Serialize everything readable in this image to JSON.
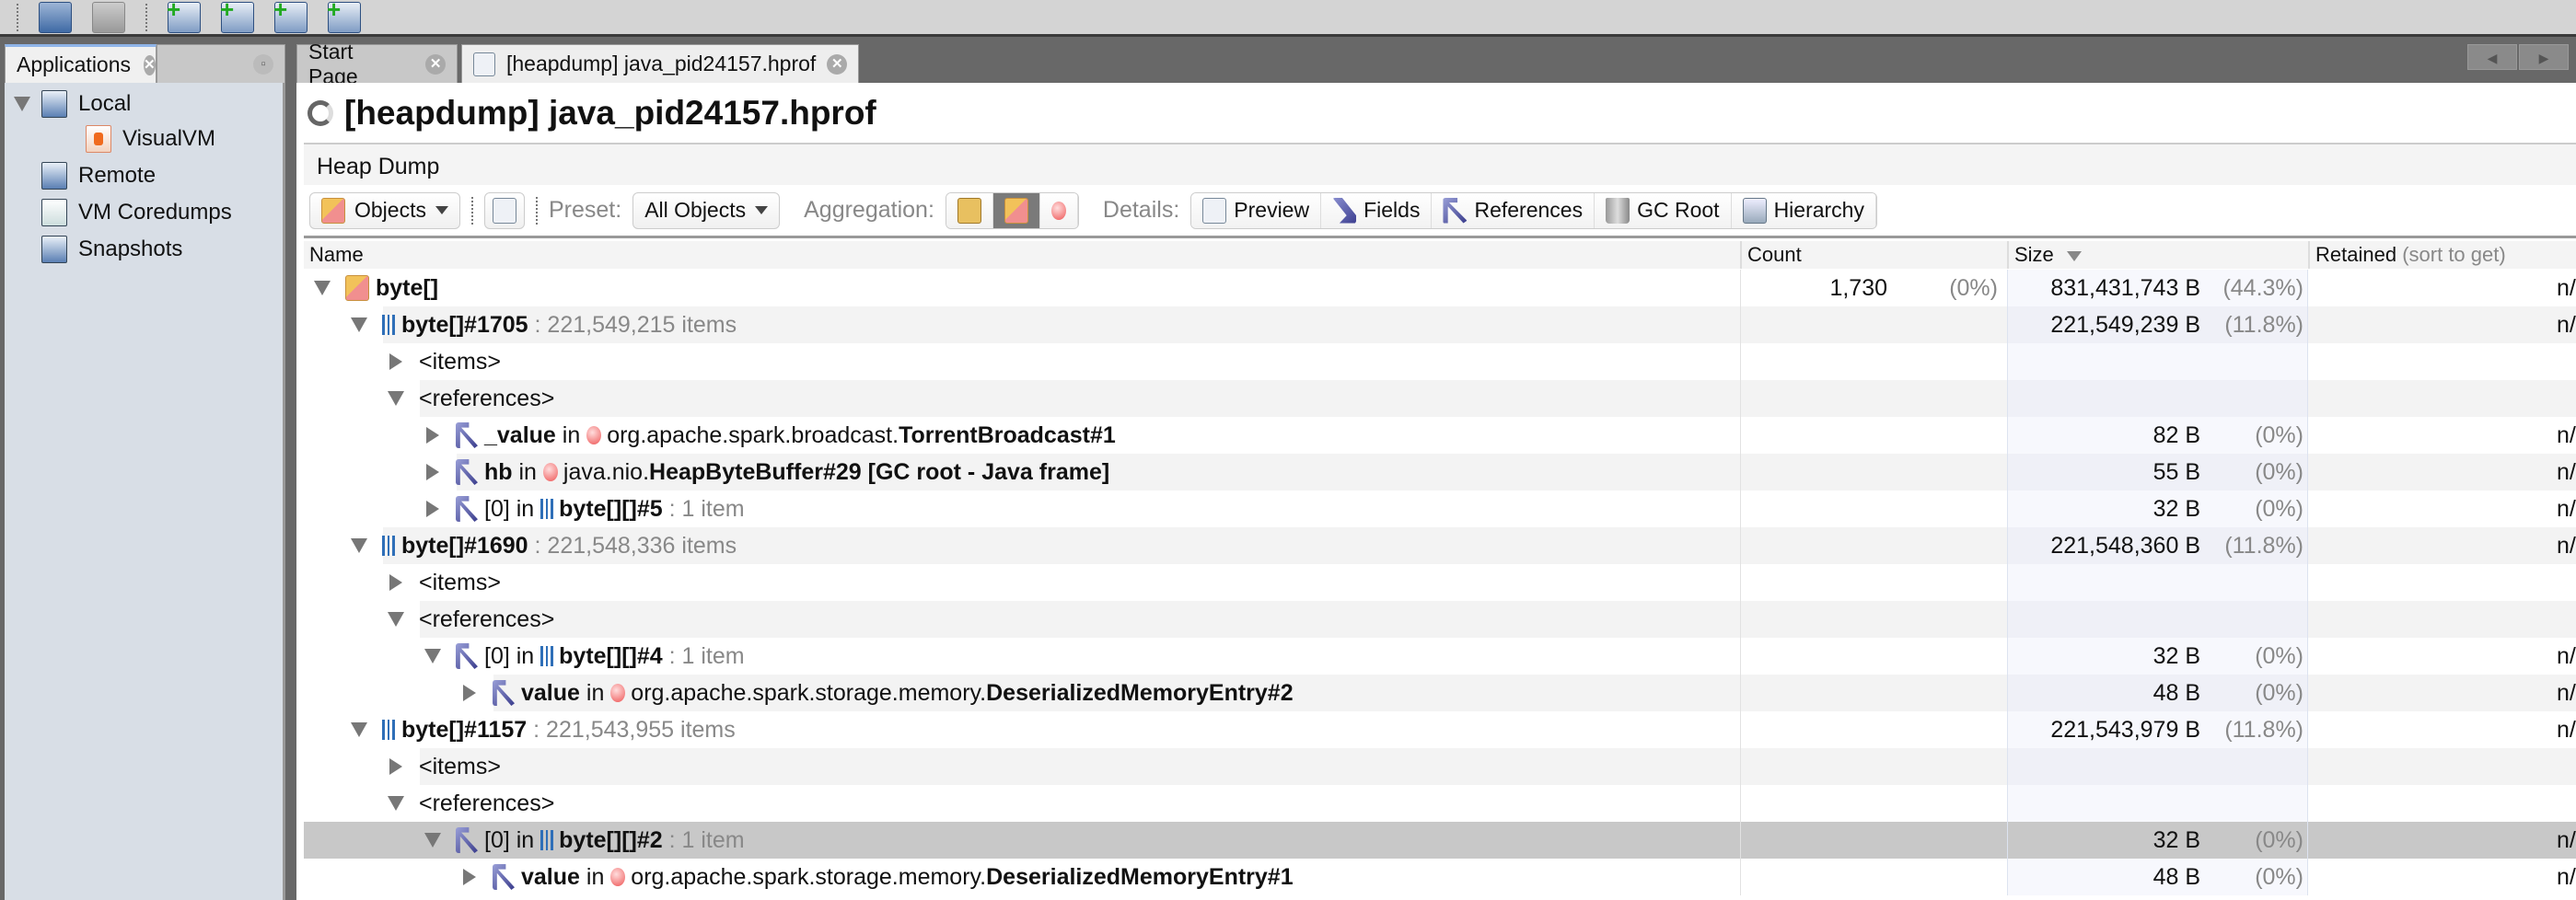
{
  "toolbar_icons": [
    "open-file-icon",
    "save-icon",
    "add-jmx-connection-icon",
    "add-jmx-icon",
    "add-coredump-icon",
    "add-snapshot-icon"
  ],
  "left_panel": {
    "tab_label": "Applications",
    "tree": [
      {
        "label": "Local",
        "icon": "computer-icon",
        "level": 0,
        "expanded": true
      },
      {
        "label": "VisualVM",
        "icon": "visualvm-app-icon",
        "level": 1
      },
      {
        "label": "Remote",
        "icon": "remote-host-icon",
        "level": 0
      },
      {
        "label": "VM Coredumps",
        "icon": "coredump-icon",
        "level": 0
      },
      {
        "label": "Snapshots",
        "icon": "snapshots-icon",
        "level": 0
      }
    ]
  },
  "tabs": [
    {
      "label": "Start Page",
      "active": false
    },
    {
      "label": "[heapdump] java_pid24157.hprof",
      "active": true
    }
  ],
  "page_title": "[heapdump] java_pid24157.hprof",
  "section_title": "Heap Dump",
  "heap_toolbar": {
    "view_label": "Objects",
    "preset_label": "Preset:",
    "preset_value": "All Objects",
    "aggregation_label": "Aggregation:",
    "aggregation_selected": "classes",
    "details_label": "Details:",
    "details_buttons": [
      "Preview",
      "Fields",
      "References",
      "GC Root",
      "Hierarchy"
    ]
  },
  "columns": {
    "name": "Name",
    "count": "Count",
    "size": "Size",
    "retained": "Retained",
    "retained_hint": "(sort to get)"
  },
  "colors": {
    "selected_row": "#c8c8c8",
    "stripe": "#f3f3f3",
    "size_column": "#f7f8fd"
  },
  "rows": [
    {
      "level": 0,
      "toggle": "expanded",
      "icon": "class-icon",
      "parts": [
        [
          "byte[]",
          "b"
        ]
      ],
      "count": "1,730",
      "count_pct": "(0%)",
      "size": "831,431,743 B",
      "size_pct": "(44.3%)",
      "retained": "n/a"
    },
    {
      "level": 1,
      "toggle": "expanded",
      "icon": "array-icon",
      "parts": [
        [
          "byte[]#1705",
          "b"
        ],
        [
          " : 221,549,215 items",
          "g"
        ]
      ],
      "size": "221,549,239 B",
      "size_pct": "(11.8%)",
      "retained": "n/a"
    },
    {
      "level": 2,
      "toggle": "collapsed",
      "parts": [
        [
          "<items>",
          ""
        ]
      ]
    },
    {
      "level": 2,
      "toggle": "expanded",
      "parts": [
        [
          "<references>",
          ""
        ]
      ]
    },
    {
      "level": 3,
      "toggle": "collapsed",
      "icon": "reference-icon",
      "parts": [
        [
          "_value",
          "b"
        ],
        [
          " in ",
          ""
        ],
        [
          "@inst",
          ""
        ],
        [
          "org.apache.spark.broadcast.",
          ""
        ],
        [
          "TorrentBroadcast#1",
          "b"
        ]
      ],
      "size": "82 B",
      "size_pct": "(0%)",
      "retained": "n/a"
    },
    {
      "level": 3,
      "toggle": "collapsed",
      "icon": "reference-icon",
      "parts": [
        [
          "hb",
          "b"
        ],
        [
          " in ",
          ""
        ],
        [
          "@inst",
          ""
        ],
        [
          "java.nio.",
          ""
        ],
        [
          "HeapByteBuffer#29 [GC root - Java frame]",
          "b"
        ]
      ],
      "size": "55 B",
      "size_pct": "(0%)",
      "retained": "n/a"
    },
    {
      "level": 3,
      "toggle": "collapsed",
      "icon": "reference-icon",
      "parts": [
        [
          "[0]",
          ""
        ],
        [
          " in ",
          ""
        ],
        [
          "@arr",
          ""
        ],
        [
          "byte[][]#5",
          "b"
        ],
        [
          " : 1 item",
          "g"
        ]
      ],
      "size": "32 B",
      "size_pct": "(0%)",
      "retained": "n/a"
    },
    {
      "level": 1,
      "toggle": "expanded",
      "icon": "array-icon",
      "parts": [
        [
          "byte[]#1690",
          "b"
        ],
        [
          " : 221,548,336 items",
          "g"
        ]
      ],
      "size": "221,548,360 B",
      "size_pct": "(11.8%)",
      "retained": "n/a"
    },
    {
      "level": 2,
      "toggle": "collapsed",
      "parts": [
        [
          "<items>",
          ""
        ]
      ]
    },
    {
      "level": 2,
      "toggle": "expanded",
      "parts": [
        [
          "<references>",
          ""
        ]
      ]
    },
    {
      "level": 3,
      "toggle": "expanded",
      "icon": "reference-icon",
      "parts": [
        [
          "[0]",
          ""
        ],
        [
          " in ",
          ""
        ],
        [
          "@arr",
          ""
        ],
        [
          "byte[][]#4",
          "b"
        ],
        [
          " : 1 item",
          "g"
        ]
      ],
      "size": "32 B",
      "size_pct": "(0%)",
      "retained": "n/a"
    },
    {
      "level": 4,
      "toggle": "collapsed",
      "icon": "reference-icon",
      "parts": [
        [
          "value",
          "b"
        ],
        [
          " in ",
          ""
        ],
        [
          "@inst",
          ""
        ],
        [
          "org.apache.spark.storage.memory.",
          ""
        ],
        [
          "DeserializedMemoryEntry#2",
          "b"
        ]
      ],
      "size": "48 B",
      "size_pct": "(0%)",
      "retained": "n/a"
    },
    {
      "level": 1,
      "toggle": "expanded",
      "icon": "array-icon",
      "parts": [
        [
          "byte[]#1157",
          "b"
        ],
        [
          " : 221,543,955 items",
          "g"
        ]
      ],
      "size": "221,543,979 B",
      "size_pct": "(11.8%)",
      "retained": "n/a"
    },
    {
      "level": 2,
      "toggle": "collapsed",
      "parts": [
        [
          "<items>",
          ""
        ]
      ]
    },
    {
      "level": 2,
      "toggle": "expanded",
      "parts": [
        [
          "<references>",
          ""
        ]
      ]
    },
    {
      "level": 3,
      "toggle": "expanded",
      "icon": "reference-icon",
      "selected": true,
      "parts": [
        [
          "[0]",
          ""
        ],
        [
          " in ",
          ""
        ],
        [
          "@arr",
          ""
        ],
        [
          "byte[][]#2",
          "b"
        ],
        [
          " : 1 item",
          "g"
        ]
      ],
      "size": "32 B",
      "size_pct": "(0%)",
      "retained": "n/a"
    },
    {
      "level": 4,
      "toggle": "collapsed",
      "icon": "reference-icon",
      "parts": [
        [
          "value",
          "b"
        ],
        [
          " in ",
          ""
        ],
        [
          "@inst",
          ""
        ],
        [
          "org.apache.spark.storage.memory.",
          ""
        ],
        [
          "DeserializedMemoryEntry#1",
          "b"
        ]
      ],
      "size": "48 B",
      "size_pct": "(0%)",
      "retained": "n/a"
    }
  ]
}
